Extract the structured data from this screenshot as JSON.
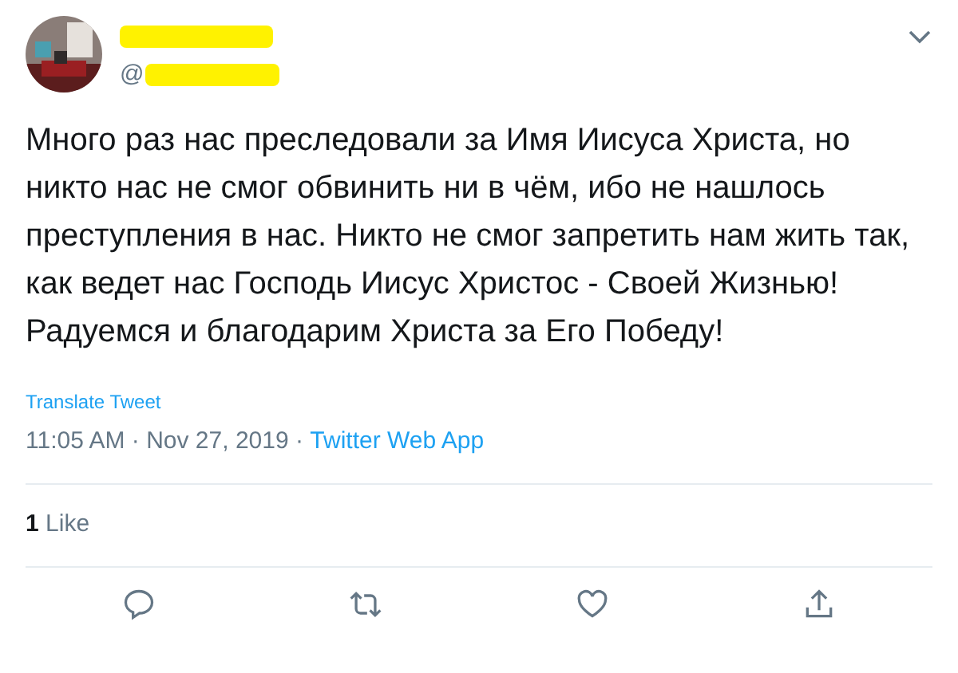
{
  "author": {
    "handle_prefix": "@"
  },
  "text": "Много раз нас преследовали за Имя Иисуса Христа, но никто нас не смог обвинить ни в чём, ибо не нашлось преступления в нас. Никто не смог запретить нам жить так, как ведет нас Господь Иисус Христос - Своей Жизнью! Радуемся и благодарим Христа за Его Победу!",
  "translate": "Translate Tweet",
  "timestamp": "11:05 AM · Nov 27, 2019 · ",
  "source": "Twitter Web App",
  "likes": {
    "count": "1",
    "label": "Like"
  },
  "actions": [
    {
      "kind": "reply"
    },
    {
      "kind": "retweet"
    },
    {
      "kind": "like"
    },
    {
      "kind": "share"
    }
  ]
}
